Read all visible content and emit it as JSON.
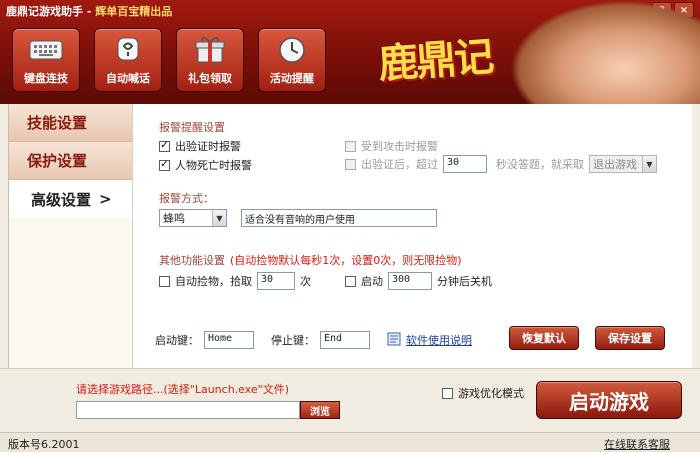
{
  "window": {
    "title": "鹿鼎记游戏助手 - ",
    "subtitle": "辉单百宝精出品",
    "minimize": "?",
    "close": "×"
  },
  "toolbar": [
    {
      "label": "键盘连技",
      "icon": "keyboard-icon"
    },
    {
      "label": "自动喊话",
      "icon": "speech-icon"
    },
    {
      "label": "礼包领取",
      "icon": "gift-icon"
    },
    {
      "label": "活动提醒",
      "icon": "clock-icon"
    }
  ],
  "logo": {
    "text": "鹿鼎记"
  },
  "sidebar": {
    "items": [
      {
        "label": "技能设置"
      },
      {
        "label": "保护设置"
      },
      {
        "label": "高级设置",
        "chevron": ">"
      }
    ]
  },
  "alarm": {
    "section_title": "报警提醒设置",
    "verify_alarm": {
      "label": "出验证时报警",
      "checked": true
    },
    "death_alarm": {
      "label": "人物死亡时报警",
      "checked": true
    },
    "attacked_alarm": {
      "label": "受到攻击时报警",
      "checked": false
    },
    "after_verify": {
      "label_before": "出验证后，超过",
      "value": "30",
      "label_after": "秒没答题，就采取",
      "action": "退出游戏",
      "checked": false
    }
  },
  "alarm_mode": {
    "section_title": "报警方式：",
    "selected": "蜂鸣",
    "description": "适合没有音响的用户使用"
  },
  "other": {
    "section_title": "其他功能设置",
    "note": "(自动捡物默认每秒1次，设置0次，则无限捡物)",
    "auto_pickup": {
      "label_before": "自动捡物，拾取",
      "value": "30",
      "label_after": "次"
    },
    "shutdown": {
      "label_before": "启动",
      "value": "300",
      "label_after": "分钟后关机"
    }
  },
  "hotkeys": {
    "start_label": "启动键：",
    "start_value": "Home",
    "stop_label": "停止键：",
    "stop_value": "End",
    "help_link": "软件使用说明"
  },
  "actions": {
    "restore": "恢复默认",
    "save": "保存设置"
  },
  "launch": {
    "hint": "请选择游戏路径...(选择\"Launch.exe\"文件)",
    "path_value": "",
    "browse": "浏览",
    "optimize_label": "游戏优化模式",
    "start": "启动游戏"
  },
  "status": {
    "version": "版本号6.2001",
    "support_link": "在线联系客服"
  }
}
